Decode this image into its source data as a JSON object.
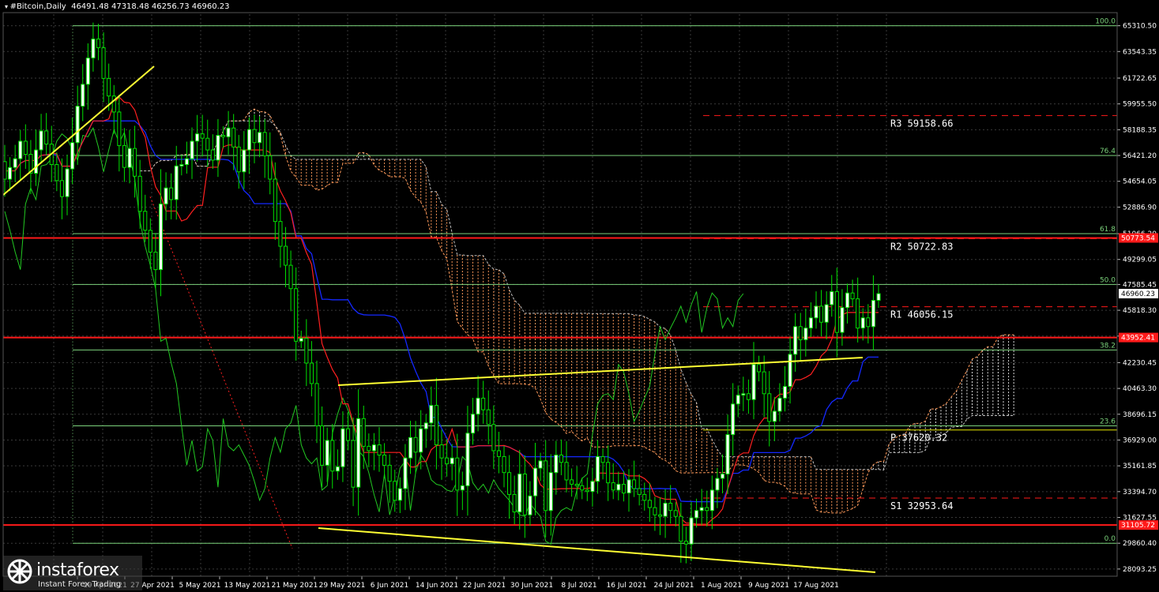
{
  "header": {
    "symbol": "#Bitcoin,Daily",
    "ohlc": "46491.48 47318.48 46256.73 46960.23"
  },
  "brand": {
    "name": "instaforex",
    "tagline": "Instant Forex Trading"
  },
  "colors": {
    "background": "#000000",
    "grid": "#3a3a3a",
    "bull_candle": "#ffffff",
    "bear_candle": "#000000",
    "candle_outline": "#00e000",
    "tenkan": "#ff2020",
    "kijun": "#1428ff",
    "chikou": "#22c822",
    "cloud": "#ff9a5a",
    "fib": "#7bd27b",
    "level_solid": "#ff1a1a",
    "trendline": "#ffff33",
    "pivot_p": "#e6e600",
    "price_label_bg": "#ff1a1a",
    "current_price_bg": "#ffffff"
  },
  "chart_data": {
    "type": "candlestick",
    "y_axis": {
      "min": 28093,
      "max": 66000,
      "tick_labels": [
        "65310.50",
        "63543.35",
        "61722.65",
        "59955.50",
        "58188.35",
        "56421.20",
        "54654.05",
        "52886.90",
        "51066.20",
        "49299.05",
        "47585.45",
        "45818.30",
        "44051.15",
        "42230.45",
        "40463.30",
        "38696.15",
        "36929.00",
        "35161.85",
        "33394.70",
        "31627.55",
        "29860.40",
        "28093.25"
      ]
    },
    "x_axis": {
      "tick_labels": [
        "19 Apr 2021",
        "27 Apr 2021",
        "5 May 2021",
        "13 May 2021",
        "21 May 2021",
        "29 May 2021",
        "6 Jun 2021",
        "14 Jun 2021",
        "22 Jun 2021",
        "30 Jun 2021",
        "8 Jul 2021",
        "16 Jul 2021",
        "24 Jul 2021",
        "1 Aug 2021",
        "9 Aug 2021",
        "17 Aug 2021"
      ]
    },
    "current_price": "46960.23",
    "fib_levels": [
      {
        "label": "100.0",
        "value": 65310
      },
      {
        "label": "76.4",
        "value": 56421
      },
      {
        "label": "61.8",
        "value": 51066
      },
      {
        "label": "50.0",
        "value": 47585
      },
      {
        "label": "38.2",
        "value": 43100
      },
      {
        "label": "23.6",
        "value": 37900
      },
      {
        "label": "0.0",
        "value": 29860
      }
    ],
    "horizontal_levels": [
      {
        "label": "50773.54",
        "value": 50773.54
      },
      {
        "label": "43952.41",
        "value": 43952.41
      },
      {
        "label": "31105.72",
        "value": 31105.72
      }
    ],
    "pivots": [
      {
        "label": "R3",
        "value": 59158.66,
        "text": "59158.66"
      },
      {
        "label": "R2",
        "value": 50722.83,
        "text": "50722.83"
      },
      {
        "label": "R1",
        "value": 46056.15,
        "text": "46056.15"
      },
      {
        "label": "P",
        "value": 37620.32,
        "text": "37620.32"
      },
      {
        "label": "S1",
        "value": 32953.64,
        "text": "32953.64"
      }
    ],
    "candles_close": [
      54800,
      55600,
      56200,
      57400,
      56500,
      55200,
      56800,
      58100,
      57200,
      55800,
      54700,
      53600,
      55500,
      57300,
      59800,
      61300,
      63100,
      64400,
      63800,
      61700,
      60500,
      59400,
      57100,
      55600,
      56900,
      55000,
      52600,
      51300,
      49800,
      48600,
      53100,
      54200,
      53400,
      55700,
      55800,
      56200,
      57400,
      57900,
      57600,
      56800,
      56100,
      57800,
      57700,
      58300,
      57000,
      55300,
      56800,
      58200,
      57300,
      58000,
      56400,
      54800,
      51900,
      50200,
      48900,
      47300,
      43700,
      43900,
      42200,
      40800,
      37900,
      35200,
      36900,
      34800,
      35100,
      37700,
      36900,
      33700,
      38400,
      36500,
      36200,
      36600,
      35900,
      35200,
      34100,
      32800,
      33600,
      35700,
      37100,
      36100,
      37700,
      38100,
      39300,
      36600,
      35700,
      35300,
      35700,
      33500,
      33800,
      37400,
      38700,
      39800,
      39000,
      38000,
      36200,
      35800,
      34700,
      33200,
      32000,
      34600,
      31800,
      33100,
      35000,
      35500,
      32100,
      34700,
      35900,
      35400,
      34200,
      33900,
      33800,
      33500,
      33400,
      34100,
      35800,
      35400,
      34000,
      33500,
      33900,
      33300,
      34200,
      33600,
      33200,
      32800,
      32300,
      31800,
      31700,
      32600,
      32100,
      31700,
      30000,
      29800,
      31600,
      32100,
      32300,
      32100,
      33500,
      34300,
      34600,
      37300,
      39400,
      40000,
      40100,
      39700,
      42100,
      41600,
      40100,
      38200,
      38900,
      39800,
      40600,
      42800,
      44700,
      43800,
      44600,
      45300,
      46100,
      45000,
      46200,
      47100,
      44300,
      46000,
      47000,
      46600,
      44600,
      45300,
      44700,
      46500,
      46960
    ]
  }
}
